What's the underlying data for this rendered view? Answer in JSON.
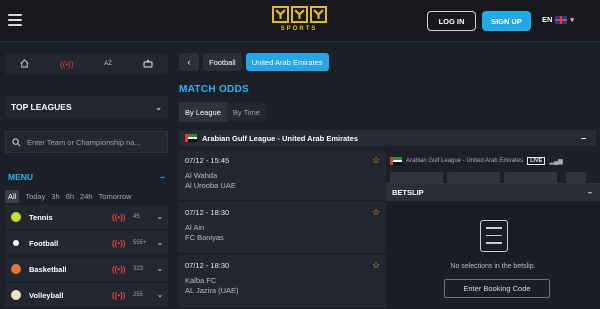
{
  "header": {
    "brand": "SPORTS",
    "login_label": "LOG IN",
    "signup_label": "SIGN UP",
    "language": "EN"
  },
  "sidebar": {
    "quick_links": [
      {
        "icon": "home-icon"
      },
      {
        "icon": "live-icon"
      },
      {
        "label": "AZ"
      },
      {
        "icon": "casino-icon"
      }
    ],
    "top_leagues_label": "TOP LEAGUES",
    "search_placeholder": "Enter Team or Championship na...",
    "menu_label": "MENU",
    "time_filters": [
      "All",
      "Today",
      "3h",
      "6h",
      "24h",
      "Tomorrow"
    ],
    "active_time_filter": "All",
    "sports": [
      {
        "name": "Tennis",
        "count": "45",
        "color": "#c7d93c"
      },
      {
        "name": "Football",
        "count": "555+",
        "color": "#ffffff"
      },
      {
        "name": "Basketball",
        "count": "323",
        "color": "#e8743b"
      },
      {
        "name": "Volleyball",
        "count": "255",
        "color": "#e9e2c8"
      }
    ]
  },
  "breadcrumb": {
    "items": [
      "Football",
      "United Arab Emirates"
    ]
  },
  "main": {
    "title": "MATCH ODDS",
    "view_tabs": [
      "By League",
      "By Time"
    ],
    "league": "Arabian Gulf League - United Arab Emirates",
    "events": [
      {
        "time": "07/12 - 15:45",
        "home": "Al Wahda",
        "away": "Al Urooba UAE"
      },
      {
        "time": "07/12 - 18:30",
        "home": "Al Ain",
        "away": "FC Baniyas"
      },
      {
        "time": "07/12 - 18:30",
        "home": "Kalba FC",
        "away": "AL Jazira (UAE)"
      }
    ],
    "featured_league": "Arabian Gulf League - United Arab Emirates",
    "live_badge": "LIVE"
  },
  "betslip": {
    "title": "BETSLIP",
    "empty_text": "No selections in the betslip.",
    "booking_label": "Enter Booking Code"
  },
  "colors": {
    "accent": "#27b4f5",
    "brand_gold": "#e7b928",
    "live_red": "#e24545",
    "signup_blue": "#22a9e8"
  }
}
